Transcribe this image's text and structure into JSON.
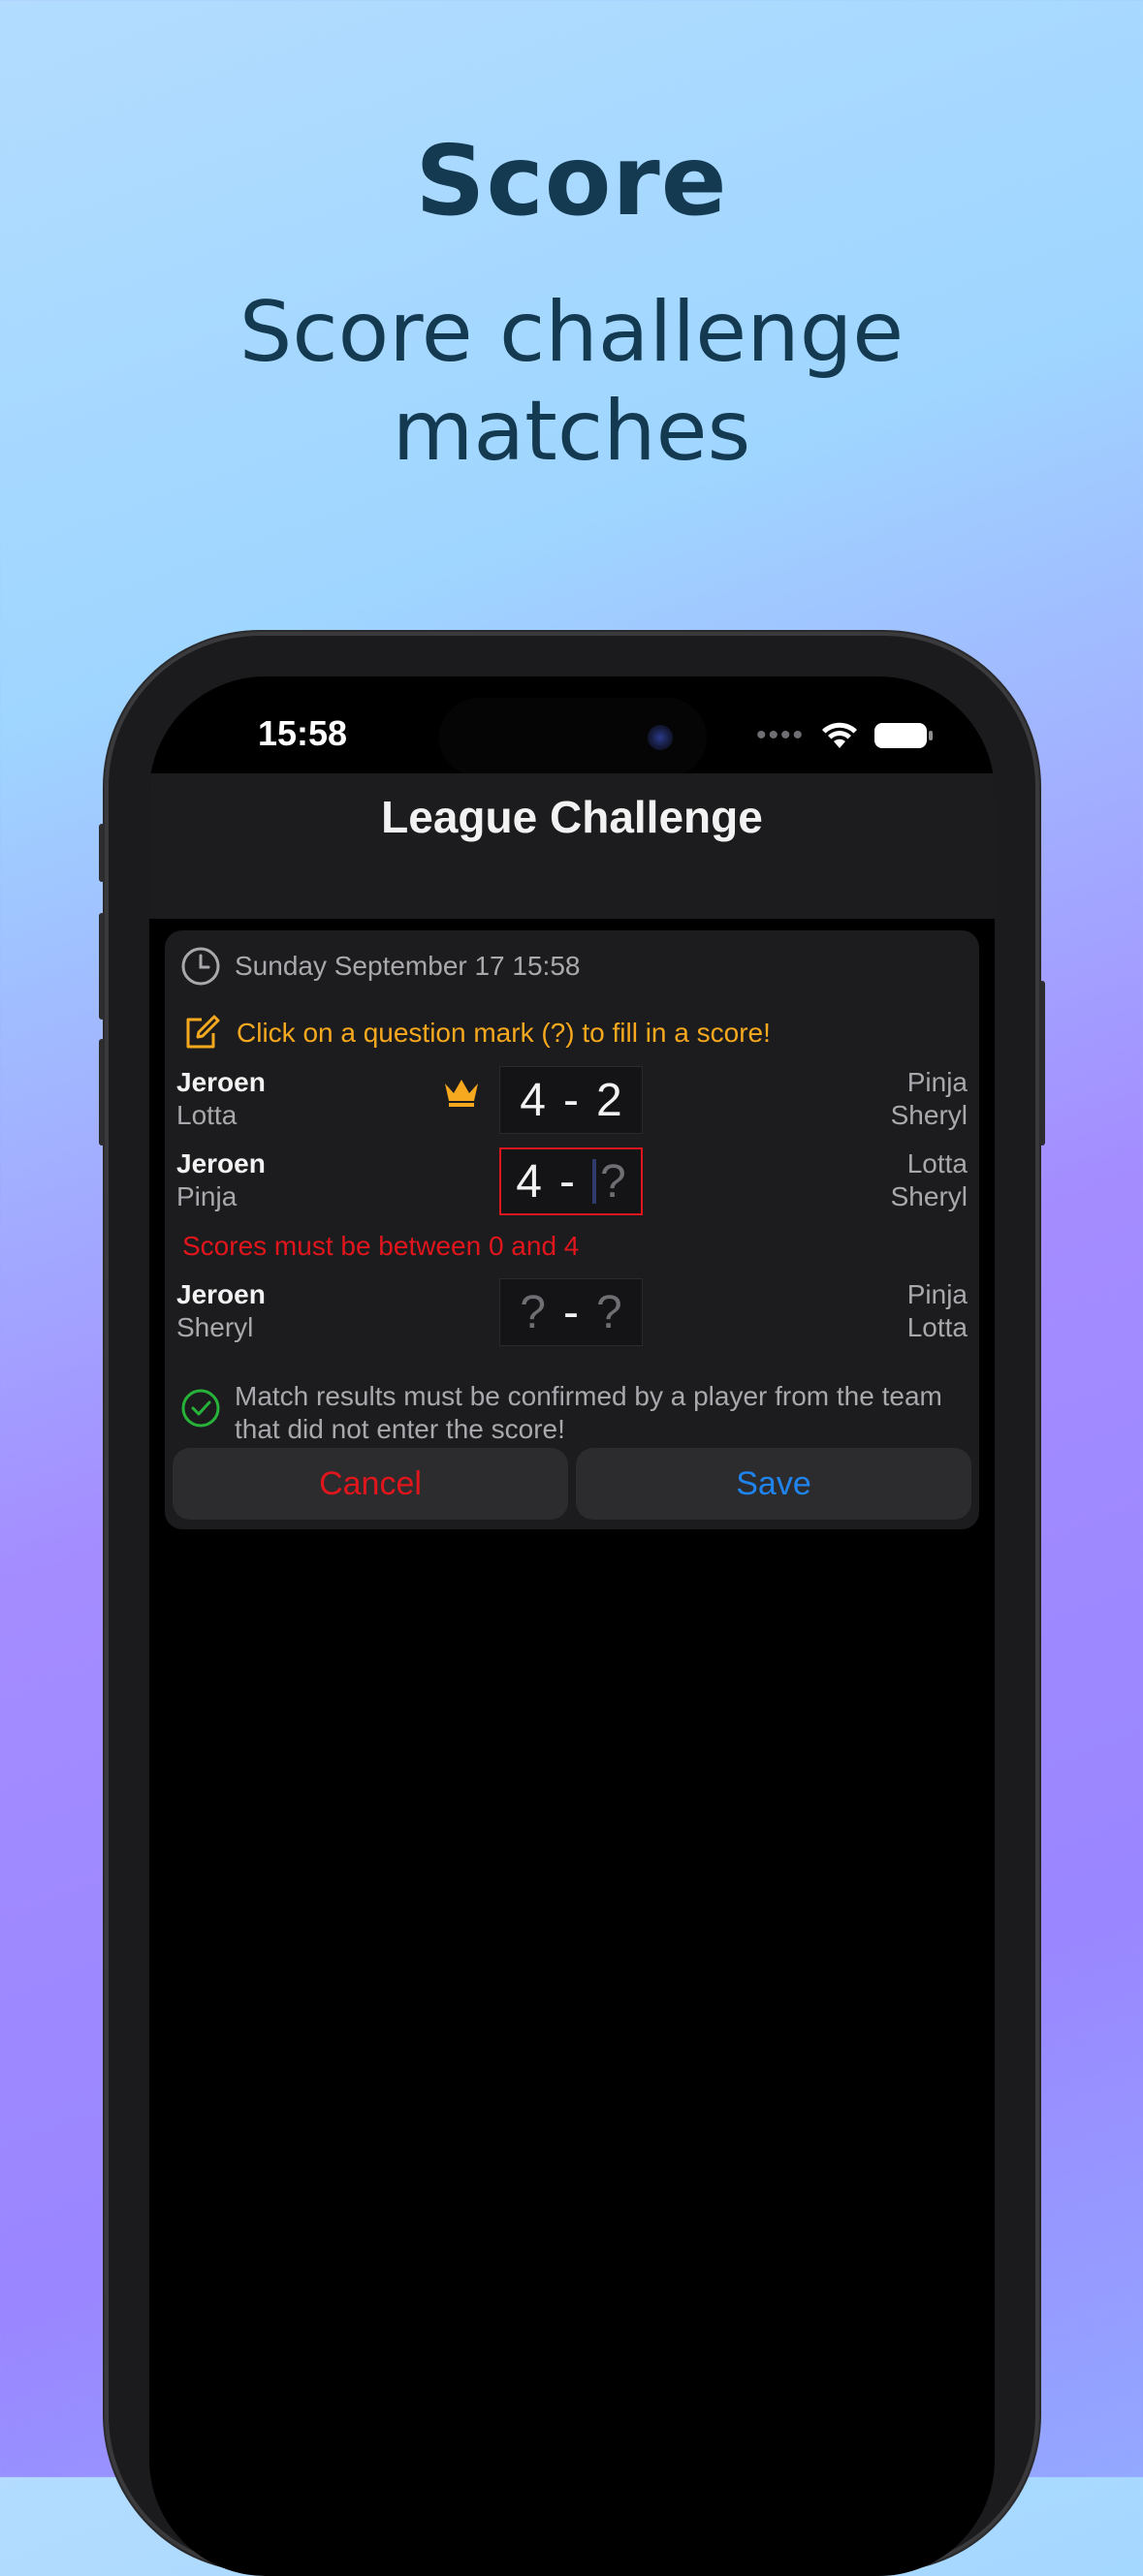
{
  "hero": {
    "title": "Score",
    "subtitle_line1": "Score challenge",
    "subtitle_line2": "matches"
  },
  "status_bar": {
    "time": "15:58"
  },
  "nav": {
    "title": "League Challenge"
  },
  "card": {
    "date": "Sunday September 17 15:58",
    "hint": "Click on a question mark (?) to fill in a score!",
    "matches": [
      {
        "left_top": "Jeroen",
        "left_bottom": "Lotta",
        "score_left": "4",
        "separator": "-",
        "score_right": "2",
        "right_top": "Pinja",
        "right_bottom": "Sheryl",
        "winner_icon": "crown-icon"
      },
      {
        "left_top": "Jeroen",
        "left_bottom": "Pinja",
        "score_left": "4",
        "separator": "-",
        "score_right": "?",
        "right_top": "Lotta",
        "right_bottom": "Sheryl"
      },
      {
        "left_top": "Jeroen",
        "left_bottom": "Sheryl",
        "score_left": "?",
        "separator": "-",
        "score_right": "?",
        "right_top": "Pinja",
        "right_bottom": "Lotta"
      }
    ],
    "error": "Scores must be between 0 and 4",
    "confirm_note": "Match results must be confirmed by a player from the team that did not enter the score!",
    "cancel_label": "Cancel",
    "save_label": "Save"
  },
  "colors": {
    "accent_orange": "#f6a81f",
    "error_red": "#e0161c",
    "link_blue": "#1f84f0",
    "confirm_green": "#27b33a"
  }
}
